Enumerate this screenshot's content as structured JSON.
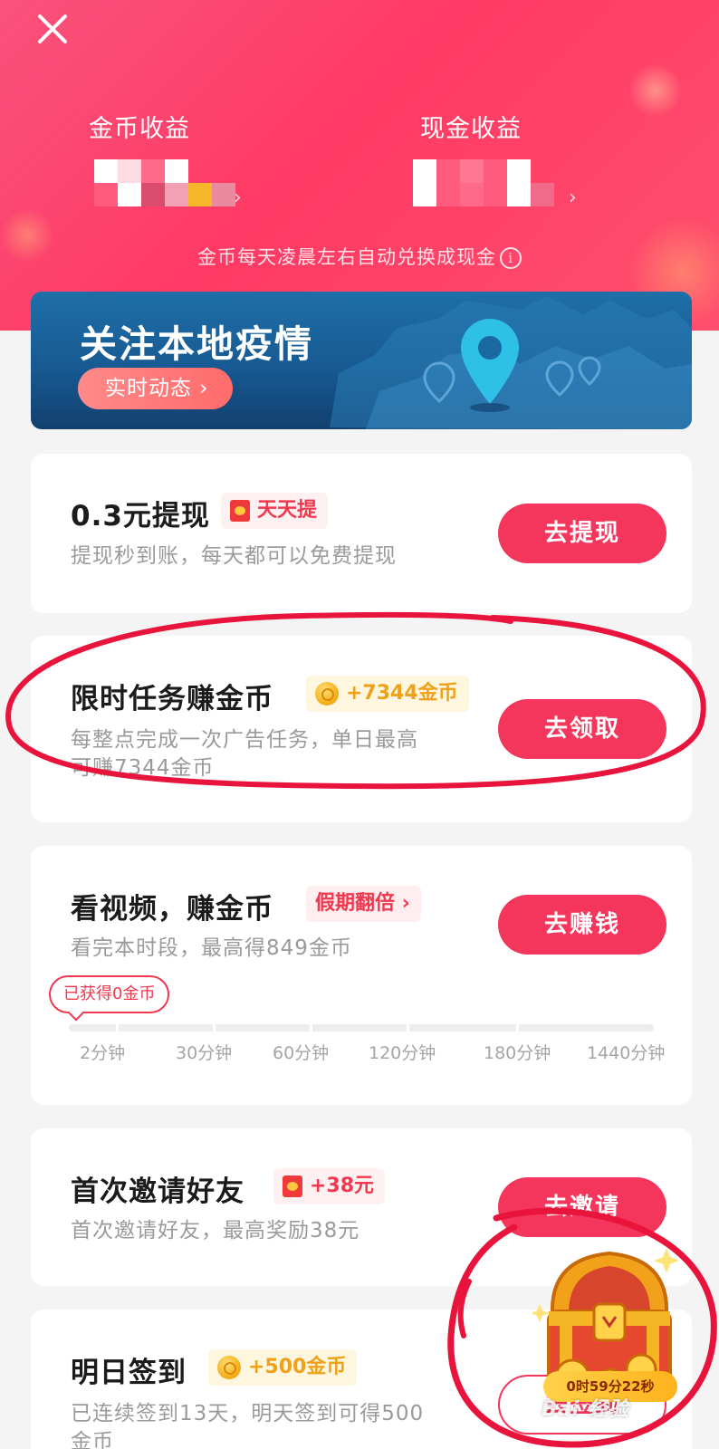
{
  "header": {
    "coin_label": "金币收益",
    "cash_label": "现金收益",
    "exchange_note": "金币每天凌晨左右自动兑换成现金",
    "info_glyph": "i",
    "arrow_glyph": "›"
  },
  "banner": {
    "title": "关注本地疫情",
    "button": "实时动态 ›"
  },
  "tasks": [
    {
      "title": "0.3元提现",
      "tag": "天天提",
      "desc": "提现秒到账，每天都可以免费提现",
      "button": "去提现"
    },
    {
      "title": "限时任务赚金币",
      "tag": "+7344金币",
      "desc_line1": "每整点完成一次广告任务，单日最高",
      "desc_line2": "可赚7344金币",
      "button": "去领取"
    },
    {
      "title": "看视频，赚金币",
      "tag": "假期翻倍 ›",
      "desc": "看完本时段，最高得849金币",
      "button": "去赚钱",
      "earned": "已获得0金币",
      "progress": 0,
      "ticks": [
        "2分钟",
        "30分钟",
        "60分钟",
        "120分钟",
        "180分钟",
        "1440分钟"
      ]
    },
    {
      "title": "首次邀请好友",
      "tag": "+38元",
      "desc": "首次邀请好友，最高奖励38元",
      "button": "去邀请"
    },
    {
      "title": "明日签到",
      "tag": "+500金币",
      "desc_line1": "已连续签到13天，明天签到可得500",
      "desc_line2": "金币",
      "button": "去签到"
    }
  ],
  "chest": {
    "timer": "0时59分22秒"
  },
  "watermark": "Bai 经验",
  "colors": {
    "accent": "#f5365c",
    "header": "#ff3a64",
    "banner": "#175a93",
    "annotation": "#e8143c"
  }
}
